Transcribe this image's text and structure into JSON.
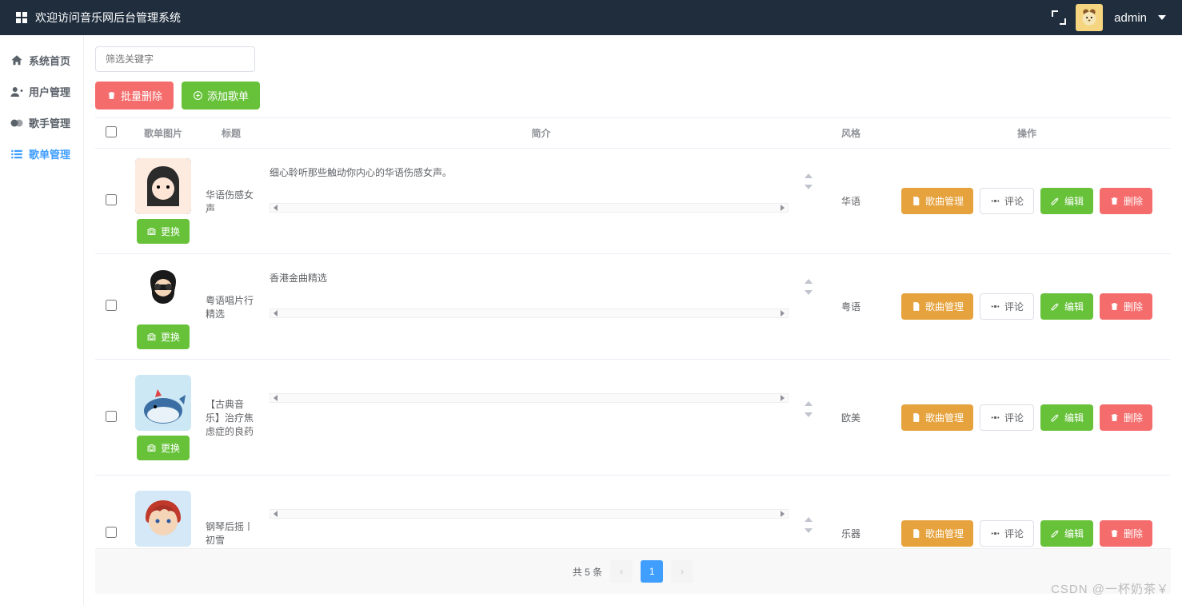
{
  "header": {
    "title": "欢迎访问音乐网后台管理系统",
    "username": "admin"
  },
  "sidebar": {
    "items": [
      {
        "label": "系统首页",
        "icon": "home"
      },
      {
        "label": "用户管理",
        "icon": "user"
      },
      {
        "label": "歌手管理",
        "icon": "artist"
      },
      {
        "label": "歌单管理",
        "icon": "list",
        "active": true
      }
    ]
  },
  "toolbar": {
    "search_placeholder": "筛选关键字",
    "batch_delete": "批量删除",
    "add_playlist": "添加歌单"
  },
  "table": {
    "columns": {
      "img": "歌单图片",
      "title": "标题",
      "intro": "简介",
      "style": "风格",
      "ops": "操作"
    },
    "row_buttons": {
      "replace": "更换",
      "song_manage": "歌曲管理",
      "comment": "评论",
      "edit": "编辑",
      "delete": "删除"
    },
    "rows": [
      {
        "title": "华语伤感女声",
        "intro": "细心聆听那些触动你内心的华语伤感女声。",
        "style": "华语",
        "avatar_bg": "#2b2b2b",
        "avatar_type": "girl"
      },
      {
        "title": "粤语唱片行精选",
        "intro": "香港金曲精选",
        "style": "粤语",
        "avatar_bg": "#ffffff",
        "avatar_type": "beard"
      },
      {
        "title": "【古典音乐】治疗焦虑症的良药",
        "intro": "",
        "style": "欧美",
        "avatar_bg": "#cde8f5",
        "avatar_type": "whale"
      },
      {
        "title": "钢琴后摇丨初雪",
        "intro": "",
        "style": "乐器",
        "avatar_bg": "#d4e8f7",
        "avatar_type": "redhair"
      }
    ]
  },
  "pagination": {
    "total_text": "共 5 条",
    "current": "1"
  },
  "watermark": "CSDN @一杯奶茶￥"
}
